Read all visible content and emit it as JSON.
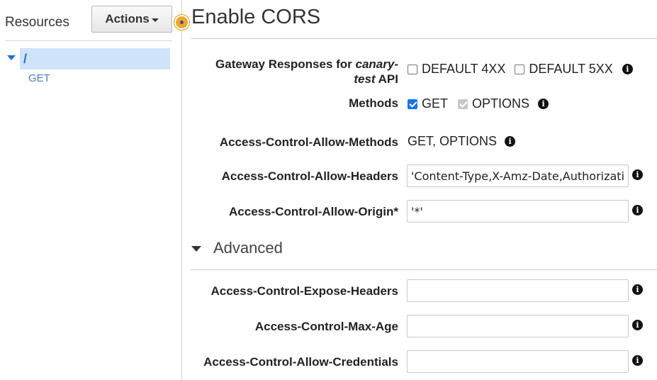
{
  "sidebar": {
    "title": "Resources",
    "actions_label": "Actions",
    "tree": {
      "path": "/",
      "method": "GET"
    }
  },
  "main": {
    "title": "Enable CORS",
    "gateway": {
      "label_prefix": "Gateway Responses for ",
      "api_name_1": "canary-",
      "api_name_2": "test",
      "label_suffix": " API",
      "options": [
        {
          "label": "DEFAULT 4XX",
          "checked": false
        },
        {
          "label": "DEFAULT 5XX",
          "checked": false
        }
      ]
    },
    "methods": {
      "label": "Methods",
      "options": [
        {
          "label": "GET",
          "checked": true,
          "disabled": false
        },
        {
          "label": "OPTIONS",
          "checked": true,
          "disabled": true
        }
      ]
    },
    "allow_methods": {
      "label": "Access-Control-Allow-Methods",
      "value": "GET, OPTIONS"
    },
    "allow_headers": {
      "label": "Access-Control-Allow-Headers",
      "value": "'Content-Type,X-Amz-Date,Authorization,X-Api-Key,X-Amz-Security-Token'"
    },
    "allow_origin": {
      "label": "Access-Control-Allow-Origin*",
      "value": "'*'"
    },
    "advanced": {
      "label": "Advanced",
      "expose_headers": {
        "label": "Access-Control-Expose-Headers",
        "value": ""
      },
      "max_age": {
        "label": "Access-Control-Max-Age",
        "value": ""
      },
      "allow_credentials": {
        "label": "Access-Control-Allow-Credentials",
        "value": ""
      }
    }
  },
  "icons": {
    "info": "i"
  }
}
